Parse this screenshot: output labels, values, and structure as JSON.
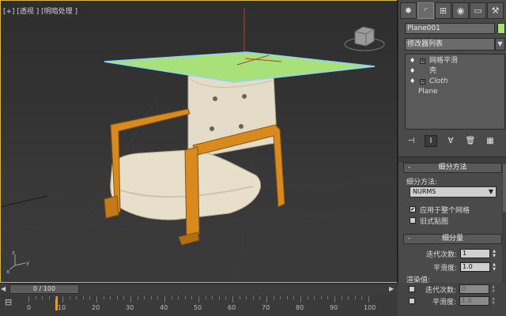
{
  "viewport": {
    "label": "[+] [透视 ] [明暗处理 ]",
    "colors": {
      "plane": "#a8e07a",
      "plane_edge": "#8ed4ff",
      "wood": "#d98a1e",
      "cushion": "#e4dcc6",
      "pivot": "#c03a2a"
    }
  },
  "panel": {
    "tabs": [
      {
        "icon": "sun-icon",
        "glyph": "✹"
      },
      {
        "icon": "modify-arc-icon",
        "glyph": "◜"
      },
      {
        "icon": "hierarchy-icon",
        "glyph": "⊞"
      },
      {
        "icon": "motion-icon",
        "glyph": "◉"
      },
      {
        "icon": "display-icon",
        "glyph": "▭"
      },
      {
        "icon": "utilities-icon",
        "glyph": "⚒"
      }
    ],
    "object_name": "Plane001",
    "object_color": "#a8e07a",
    "modifier_list": "修改器列表",
    "stack": [
      {
        "label": "网格平滑",
        "expander": "+"
      },
      {
        "label": "壳",
        "expander": ""
      },
      {
        "label": "Cloth",
        "expander": "+"
      },
      {
        "label": "Plane",
        "expander": ""
      }
    ],
    "stack_tools": [
      {
        "icon": "pin-stack-icon",
        "glyph": "⊣"
      },
      {
        "icon": "show-end-result-icon",
        "glyph": "I"
      },
      {
        "icon": "make-unique-icon",
        "glyph": "∀"
      },
      {
        "icon": "remove-modifier-icon",
        "glyph": "🗑"
      },
      {
        "icon": "configure-sets-icon",
        "glyph": "▦"
      }
    ]
  },
  "subdivision_method": {
    "title": "细分方法",
    "method_label": "细分方法:",
    "method_value": "NURMS",
    "apply_whole_mesh": "应用于整个网格",
    "apply_whole_mesh_checked": "✔",
    "old_style_mapping": "旧式贴图"
  },
  "subdivision_amount": {
    "title": "细分量",
    "iterations_label": "迭代次数:",
    "iterations_value": "1",
    "smoothness_label": "平滑度:",
    "smoothness_value": "1.0",
    "render_values_label": "渲染值:",
    "render_iterations_label": "迭代次数:",
    "render_iterations_value": "0",
    "render_smoothness_label": "平滑度:",
    "render_smoothness_value": "1.0"
  },
  "timeline": {
    "frame_display": "0 / 100",
    "ticks": [
      "0",
      "10",
      "20",
      "30",
      "40",
      "50",
      "60",
      "70",
      "80",
      "90",
      "100"
    ],
    "current_frame": 0,
    "total_frames": 100
  }
}
